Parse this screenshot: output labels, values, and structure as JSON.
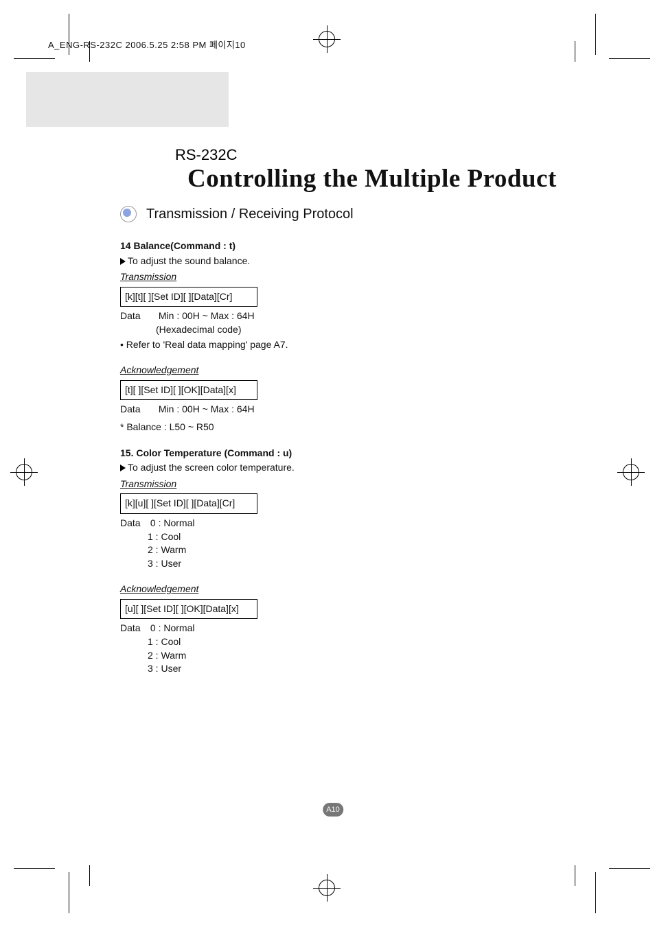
{
  "header_line": "A_ENG-RS-232C  2006.5.25  2:58 PM  페이지10",
  "subtitle": "RS-232C",
  "main_title": "Controlling the Multiple Product",
  "section_title": "Transmission / Receiving Protocol",
  "cmd14": {
    "title": "14 Balance(Command : t)",
    "desc": "To adjust the sound balance.",
    "trans_label": "Transmission",
    "trans_frame": "[k][t][ ][Set ID][ ][Data][Cr]",
    "data_label": "Data",
    "data_range": "Min : 00H ~ Max : 64H",
    "data_note": "(Hexadecimal code)",
    "ref_note": "• Refer to 'Real data mapping' page A7.",
    "ack_label": "Acknowledgement",
    "ack_frame": "[t][ ][Set ID][ ][OK][Data][x]",
    "ack_data_label": "Data",
    "ack_data_range": "Min : 00H ~ Max : 64H",
    "balance_note": "* Balance : L50 ~ R50"
  },
  "cmd15": {
    "title": "15. Color Temperature (Command : u)",
    "desc": "To adjust the screen color temperature.",
    "trans_label": "Transmission",
    "trans_frame": "[k][u][ ][Set ID][ ][Data][Cr]",
    "data_label": "Data",
    "data0": "0 : Normal",
    "data1": "1 : Cool",
    "data2": "2 : Warm",
    "data3": "3 : User",
    "ack_label": "Acknowledgement",
    "ack_frame": "[u][ ][Set ID][ ][OK][Data][x]",
    "ack_data_label": "Data",
    "ack0": "0 : Normal",
    "ack1": "1 : Cool",
    "ack2": "2 : Warm",
    "ack3": "3 : User"
  },
  "page_number": "A10"
}
